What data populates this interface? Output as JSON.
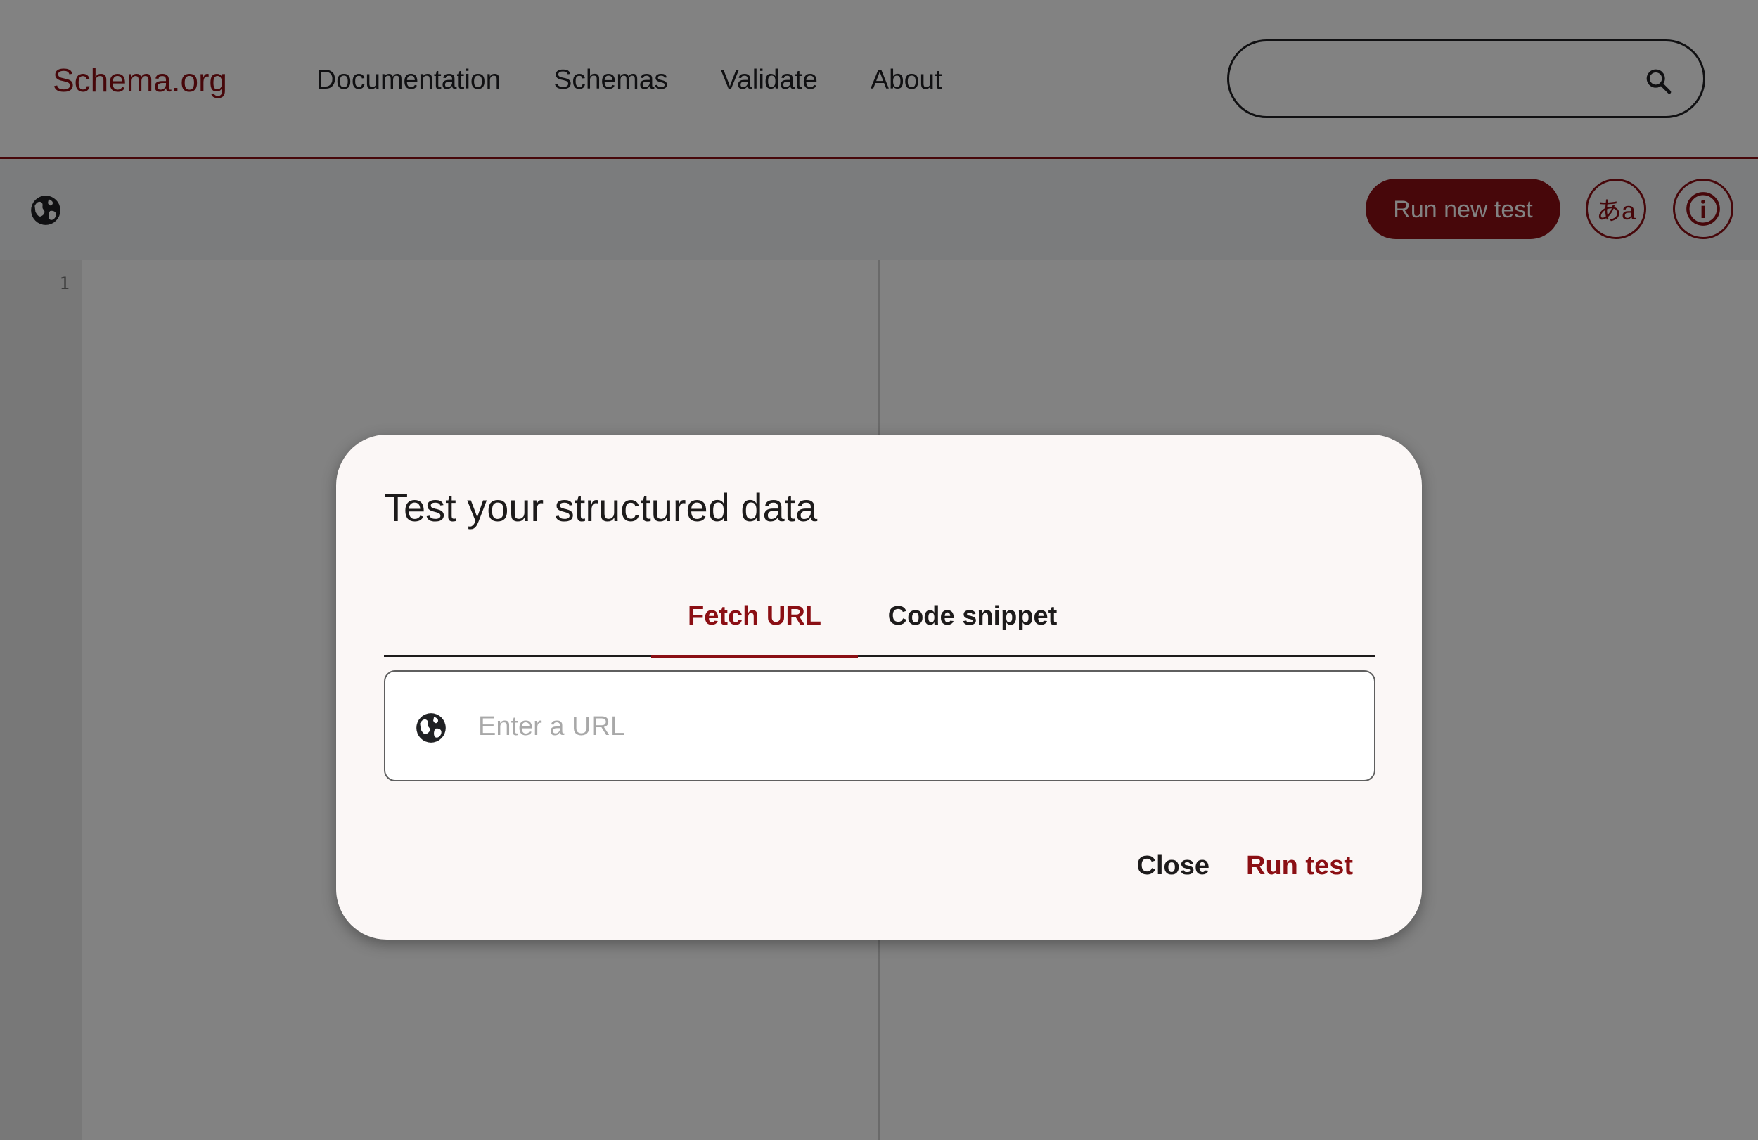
{
  "header": {
    "logo": "Schema.org",
    "nav": [
      "Documentation",
      "Schemas",
      "Validate",
      "About"
    ],
    "search_placeholder": ""
  },
  "toolbar": {
    "run_new_test_label": "Run new test",
    "language_label": "あa",
    "icons": [
      "globe-icon",
      "translate-icon",
      "info-icon"
    ]
  },
  "editor": {
    "line_numbers": [
      "1"
    ]
  },
  "dialog": {
    "title": "Test your structured data",
    "tabs": [
      "Fetch URL",
      "Code snippet"
    ],
    "active_tab": "Fetch URL",
    "url_placeholder": "Enter a URL",
    "url_value": "",
    "close_label": "Close",
    "run_label": "Run test"
  },
  "colors": {
    "brand": "#8b0f14",
    "text": "#1d1b1b",
    "dialog_bg": "#fbf7f6"
  }
}
